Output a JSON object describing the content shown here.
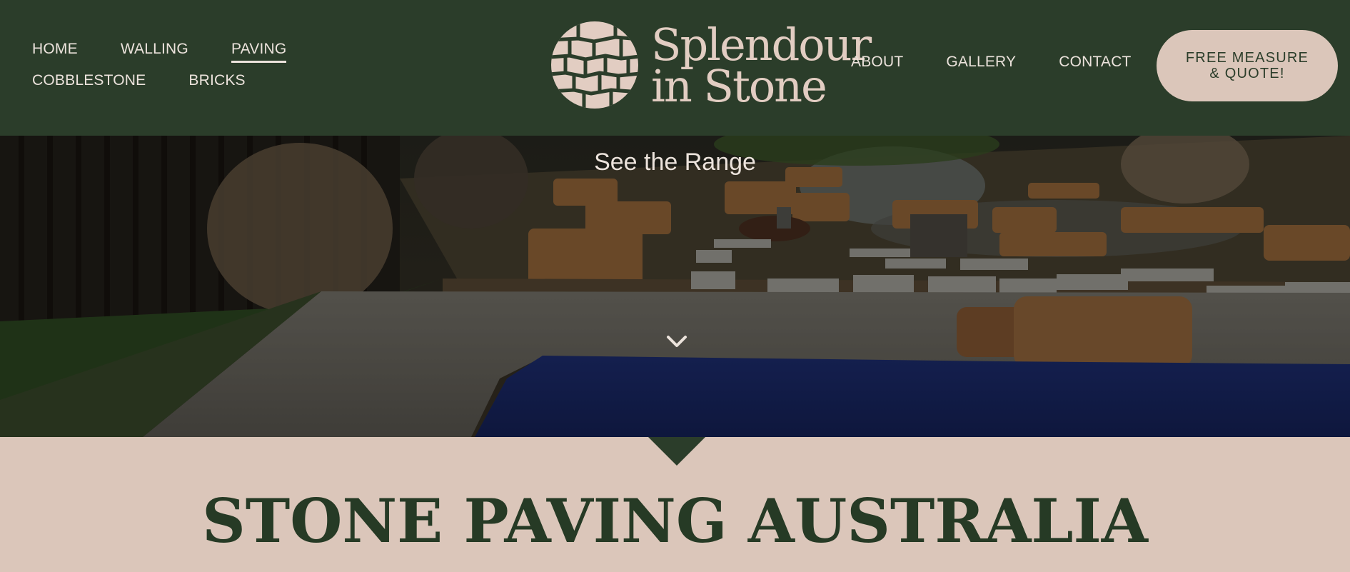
{
  "nav_left": [
    {
      "label": "HOME"
    },
    {
      "label": "WALLING"
    },
    {
      "label": "PAVING",
      "active": true
    },
    {
      "label": "COBBLESTONE"
    },
    {
      "label": "BRICKS"
    }
  ],
  "logo": {
    "line1": "Splendour",
    "line2": "in Stone"
  },
  "nav_right": [
    {
      "label": "ABOUT"
    },
    {
      "label": "GALLERY"
    },
    {
      "label": "CONTACT"
    }
  ],
  "cta": {
    "label": "FREE MEASURE & QUOTE!"
  },
  "hero": {
    "link_label": "See the Range"
  },
  "page_title": "STONE PAVING AUSTRALIA",
  "colors": {
    "header_bg": "#2b3d2a",
    "page_bg": "#dbc6ba",
    "nav_text": "#ece3dc",
    "title_text": "#263a25",
    "pool_blue": "#1b2a6b"
  },
  "icons": [
    "stone-wall-logo-icon",
    "chevron-down-icon"
  ]
}
